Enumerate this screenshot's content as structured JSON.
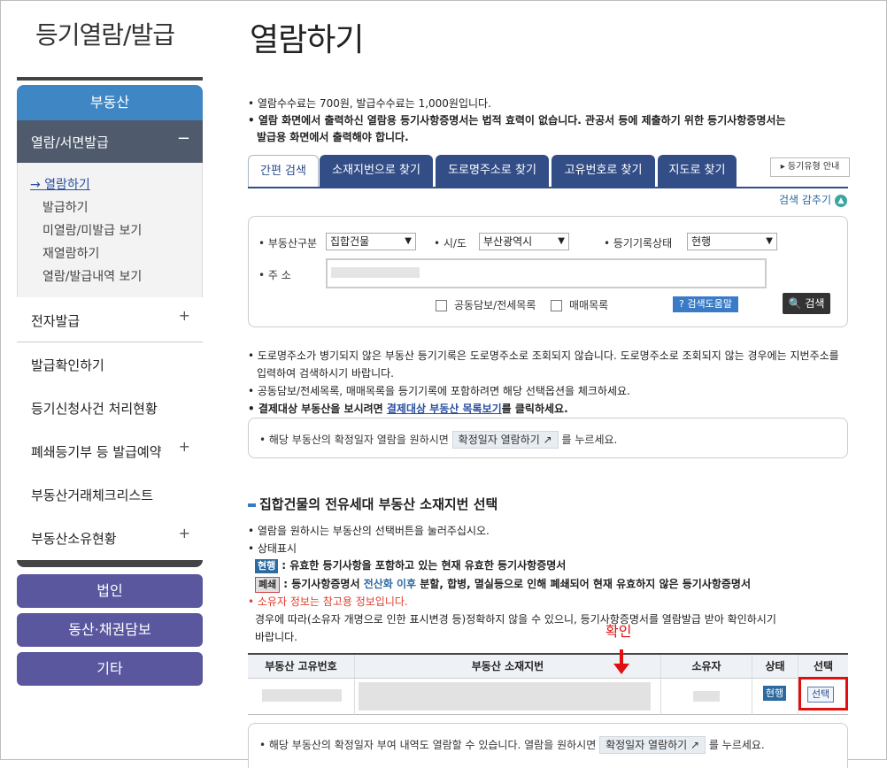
{
  "sidebar": {
    "title": "등기열람/발급",
    "section": "부동산",
    "active": "열람/서면발급",
    "active_toggle": "−",
    "sub_items": [
      "→ 열람하기",
      "발급하기",
      "미열람/미발급 보기",
      "재열람하기",
      "열람/발급내역 보기"
    ],
    "items": [
      "전자발급",
      "발급확인하기",
      "등기신청사건 처리현황",
      "폐쇄등기부 등 발급예약",
      "부동산거래체크리스트",
      "부동산소유현황"
    ],
    "plus": "+",
    "buttons": [
      "법인",
      "동산·채권담보",
      "기타"
    ]
  },
  "main": {
    "title": "열람하기",
    "notice1": "•  열람수수료는 700원, 발급수수료는 1,000원입니다.",
    "notice2": "•  열람 화면에서 출력하신 열람용 등기사항증명서는 법적 효력이 없습니다. 관공서 등에 제출하기 위한 등기사항증명서는",
    "notice3": "발급용 화면에서 출력해야 합니다.",
    "tabs": [
      "간편 검색",
      "소재지번으로 찾기",
      "도로명주소로 찾기",
      "고유번호로 찾기",
      "지도로 찾기"
    ],
    "guide_button": "▸ 등기유형 안내",
    "collapse": "검색 감추기",
    "collapse_icon": "▲"
  },
  "search": {
    "type_label": "• 부동산구분",
    "type_value": "집합건물",
    "city_label": "• 시/도",
    "city_value": "부산광역시",
    "status_label": "• 등기기록상태",
    "status_value": "현행",
    "address_label": "• 주 소",
    "check1": "공동담보/전세목록",
    "check2": "매매목록",
    "help": "? 검색도움말",
    "search_button": "🔍 검색"
  },
  "info": {
    "line1": "•  도로명주소가 병기되지 않은 부동산 등기기록은 도로명주소로 조회되지 않습니다. 도로명주소로 조회되지 않는 경우에는 지번주소를",
    "line2": "입력하여 검색하시기 바랍니다.",
    "line3": "•  공동담보/전세목록, 매매목록을 등기기록에 포함하려면 해당 선택옵션을 체크하세요.",
    "line4_pre": "•  결제대상 부동산을 보시려면 ",
    "line4_link": "결제대상 부동산 목록보기",
    "line4_post": "를 클릭하세요.",
    "bubble1_pre": "•  해당 부동산의 확정일자 열람을 원하시면",
    "confirm_button": "확정일자 열람하기 ↗",
    "bubble1_post": "를 누르세요."
  },
  "section": {
    "title": "집합건물의 전유세대 부동산 소재지번 선택",
    "l1": "•  열람을 원하시는 부동산의 선택버튼을 눌러주십시오.",
    "l2": "•  상태표시",
    "badge_current": "현행",
    "l3": ": 유효한 등기사항을 포함하고 있는 현재 유효한 등기사항증명서",
    "badge_abolished": "폐쇄",
    "l4_pre": ": 등기사항증명서 ",
    "l4_hl": "전산화 이후",
    "l4_post": " 분할, 합병, 멸실등으로 인해 폐쇄되어 현재 유효하지 않은 등기사항증명서",
    "l5": "•  소유자 정보는 참고용 정보입니다.",
    "l6": "경우에 따라(소유자 개명으로 인한 표시변경 등)정확하지 않을 수 있으니, 등기사항증명서를 열람발급 받아 확인하시기",
    "l7": "바랍니다."
  },
  "table": {
    "headers": [
      "부동산 고유번호",
      "부동산 소재지번",
      "소유자",
      "상태",
      "선택"
    ],
    "row": {
      "status": "현행",
      "select": "선택"
    }
  },
  "annotation": {
    "label": "확인"
  },
  "bottom": {
    "pre": "•  해당 부동산의 확정일자 부여 내역도 열람할 수 있습니다. 열람을 원하시면",
    "button": "확정일자 열람하기 ↗",
    "post": "를 누르세요."
  }
}
